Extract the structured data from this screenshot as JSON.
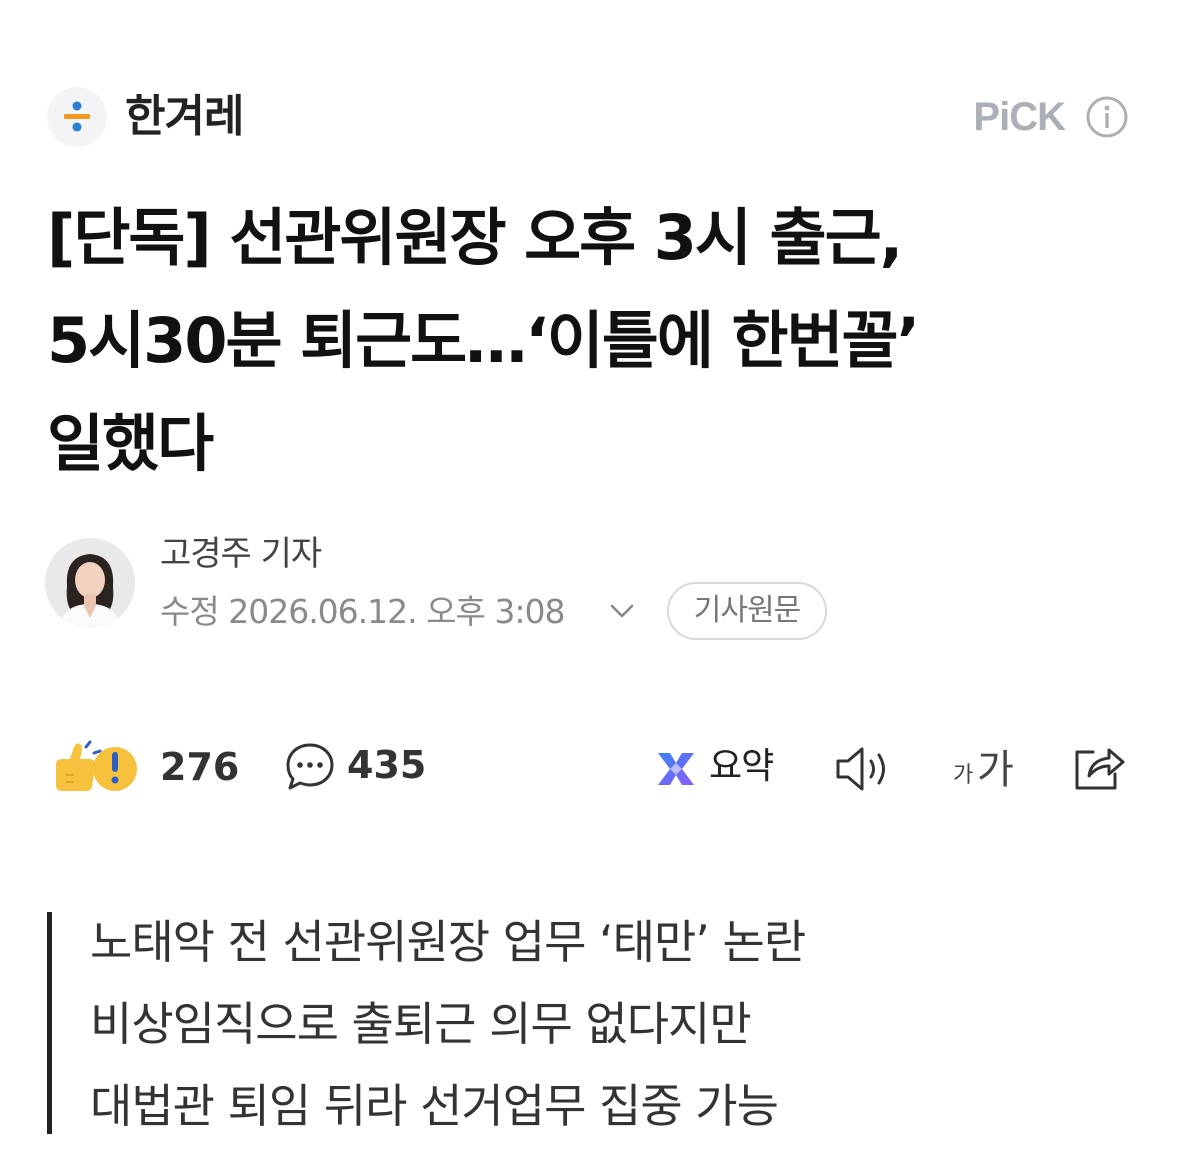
{
  "press": {
    "name": "한겨레",
    "logo_icon": "hankyoreh-logo",
    "badge": "PiCK",
    "info_icon": "info-icon"
  },
  "article": {
    "headline_lines": [
      "[단독] 선관위원장 오후 3시 출근,",
      "5시30분 퇴근도…‘이틀에 한번꼴’",
      "일했다"
    ],
    "reporter": "고경주 기자",
    "timestamp": "수정 2026.06.12. 오후 3:08",
    "original_button": "기사원문",
    "summary_lines": [
      "노태악 전 선관위원장 업무 ‘태만’ 논란",
      "비상임직으로 출퇴근 의무 없다지만",
      "대법관 퇴임 뒤라 선거업무 집중 가능"
    ]
  },
  "actions": {
    "reaction_count": "276",
    "comment_count": "435",
    "summary_label": "요약",
    "font_small": "가",
    "font_large": "가"
  },
  "colors": {
    "logo_blue": "#2a7fd4",
    "logo_orange": "#f39a1e",
    "reaction_yellow": "#f6c23e",
    "summary_blue": "#3b82f6",
    "summary_purple": "#8b5cf6"
  }
}
